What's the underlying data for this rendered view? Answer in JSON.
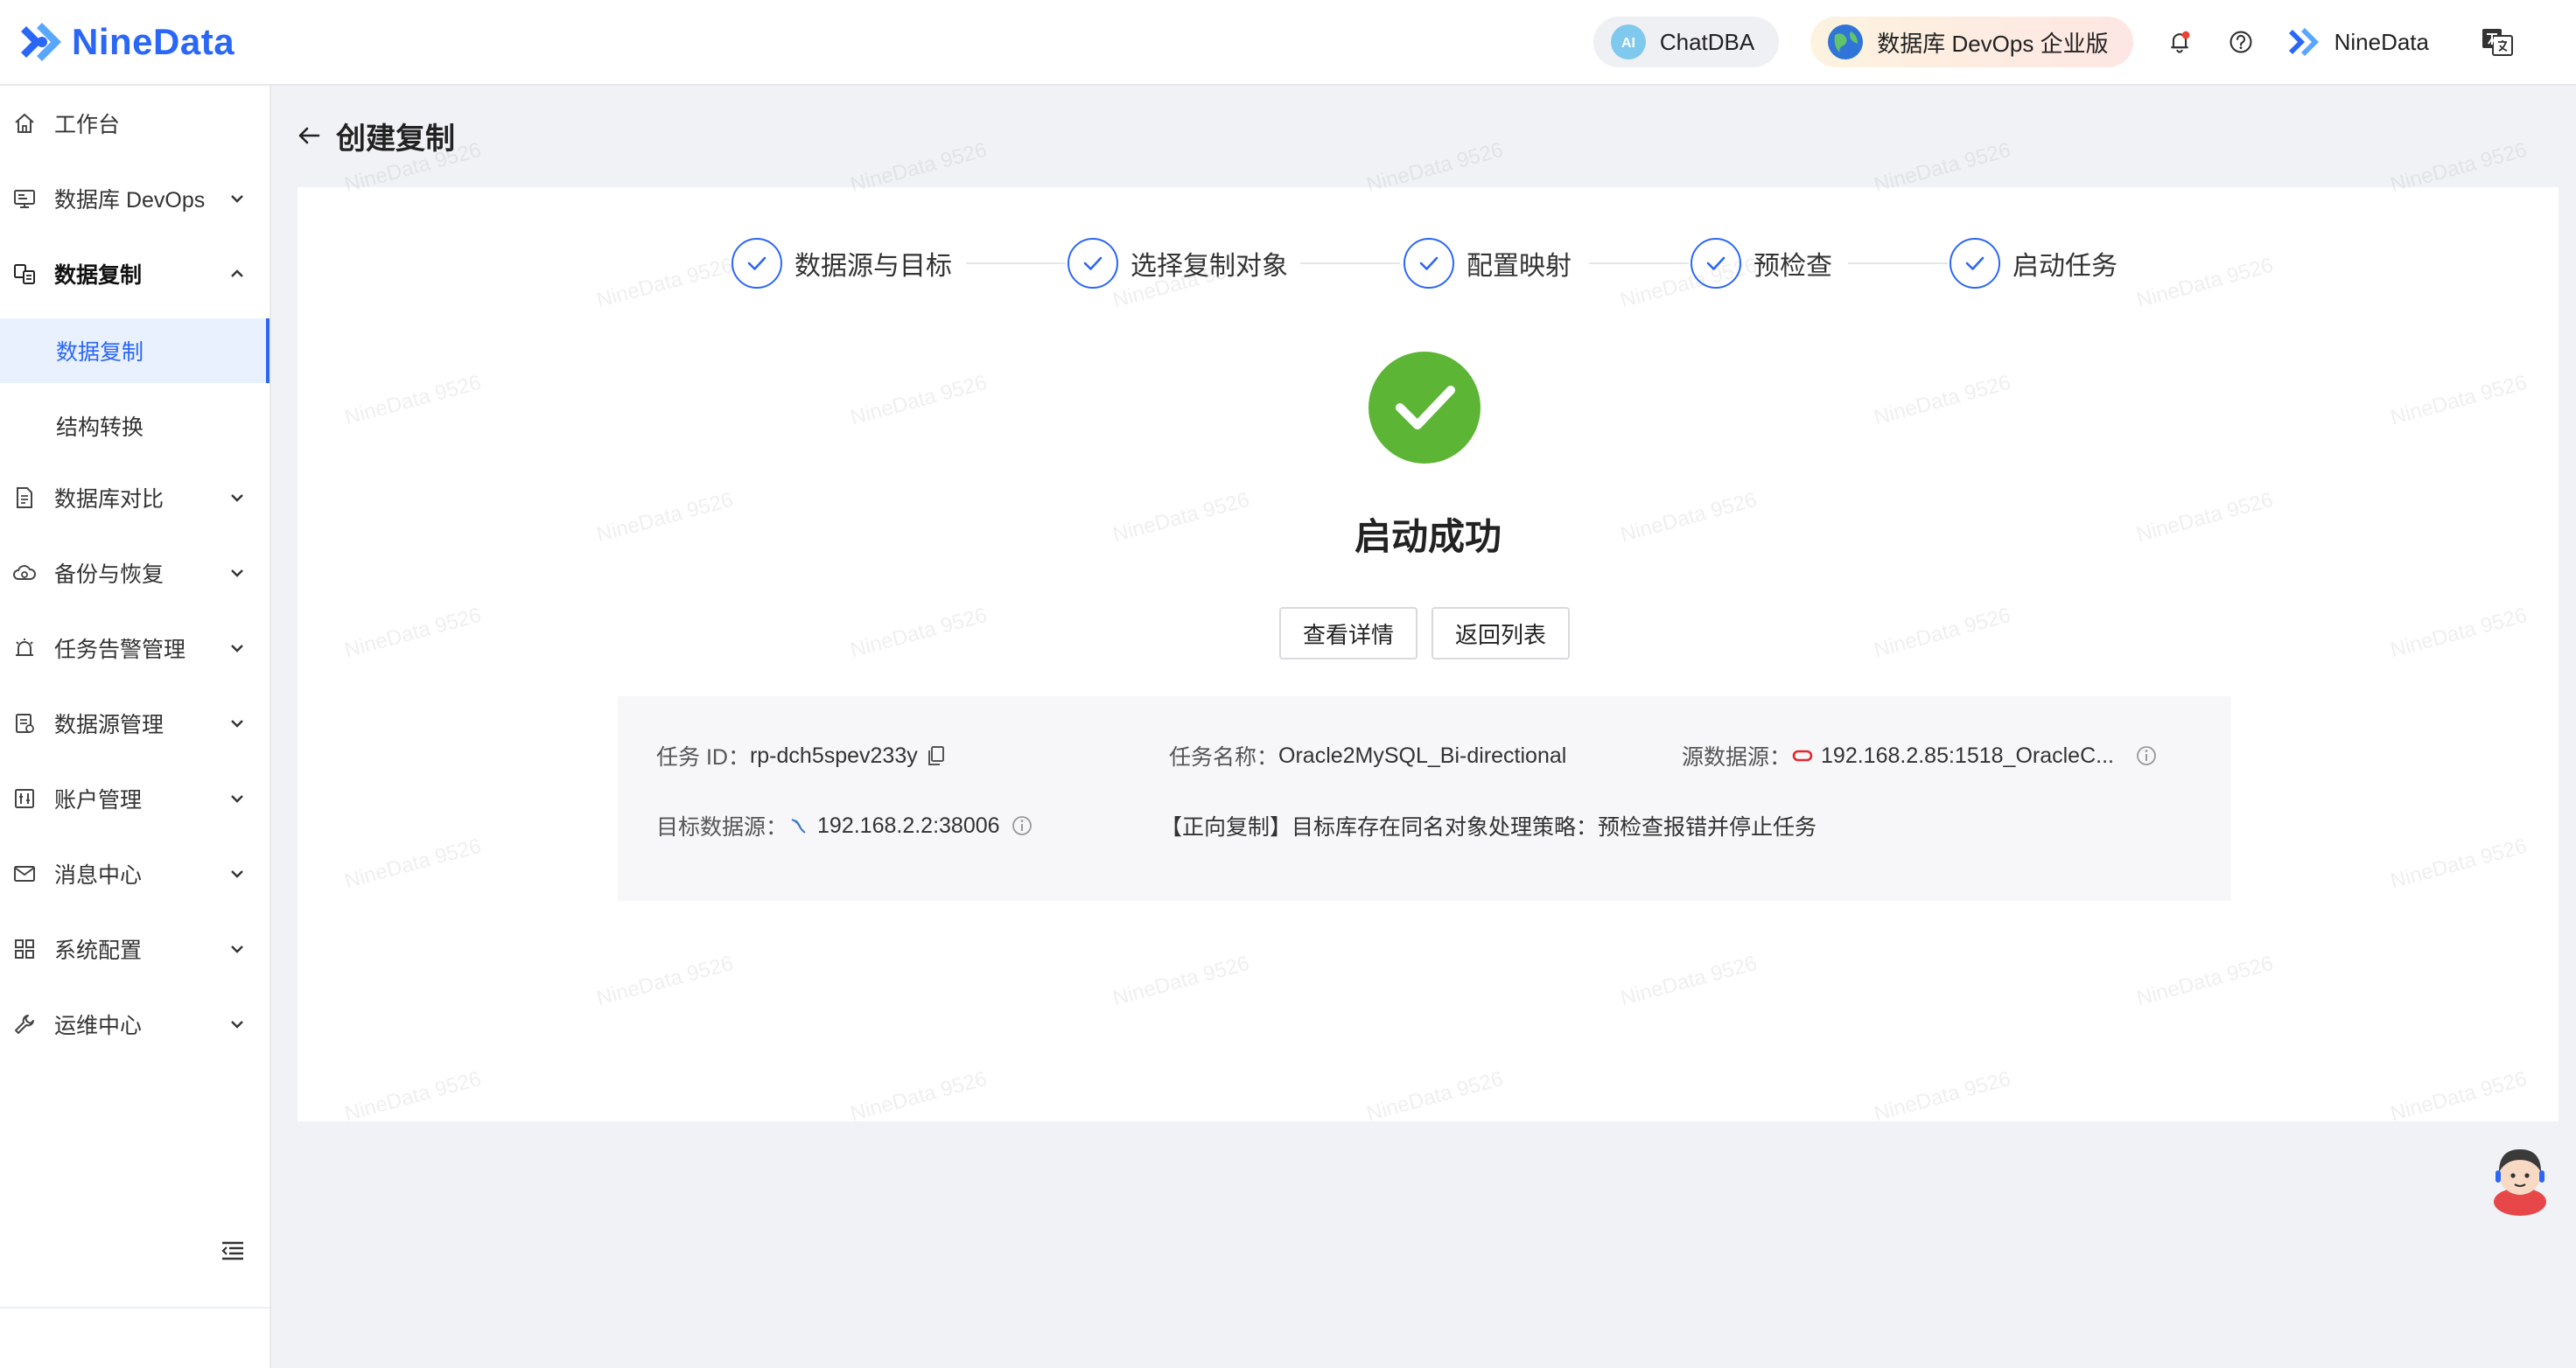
{
  "header": {
    "logo_text": "NineData",
    "chat_label": "ChatDBA",
    "devops_label": "数据库 DevOps 企业版",
    "user_name": "NineData"
  },
  "sidebar": {
    "items": [
      {
        "label": "工作台"
      },
      {
        "label": "数据库 DevOps"
      },
      {
        "label": "数据复制"
      },
      {
        "label": "数据复制"
      },
      {
        "label": "结构转换"
      },
      {
        "label": "数据库对比"
      },
      {
        "label": "备份与恢复"
      },
      {
        "label": "任务告警管理"
      },
      {
        "label": "数据源管理"
      },
      {
        "label": "账户管理"
      },
      {
        "label": "消息中心"
      },
      {
        "label": "系统配置"
      },
      {
        "label": "运维中心"
      }
    ]
  },
  "page": {
    "title": "创建复制",
    "steps": [
      "数据源与目标",
      "选择复制对象",
      "配置映射",
      "预检查",
      "启动任务"
    ],
    "success_title": "启动成功",
    "btn_details": "查看详情",
    "btn_back": "返回列表"
  },
  "info": {
    "task_id_label": "任务 ID：",
    "task_id": "rp-dch5spev233y",
    "task_name_label": "任务名称：",
    "task_name": "Oracle2MySQL_Bi-directional",
    "source_label": "源数据源：",
    "source_value": "192.168.2.85:1518_OracleC...",
    "target_label": "目标数据源：",
    "target_value": "192.168.2.2:38006",
    "strategy": "【正向复制】目标库存在同名对象处理策略：预检查报错并停止任务"
  },
  "watermark": "NineData 9526",
  "colors": {
    "brand": "#2b67f6",
    "success": "#5db535",
    "oracle": "#e0282e"
  }
}
